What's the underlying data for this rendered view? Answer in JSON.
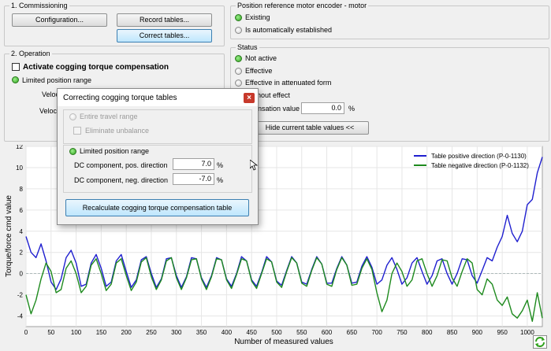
{
  "commissioning": {
    "title": "1. Commissioning",
    "configuration_btn": "Configuration...",
    "record_tables_btn": "Record tables...",
    "correct_tables_btn": "Correct tables..."
  },
  "position_reference": {
    "title": "Position reference motor encoder - motor",
    "existing": "Existing",
    "auto": "Is automatically established"
  },
  "operation": {
    "title": "2. Operation",
    "activate_label": "Activate cogging torque compensation",
    "limited_range": "Limited position range",
    "velo1": "Veloc",
    "velo2": "Veloc"
  },
  "status": {
    "title": "Status",
    "not_active": "Not active",
    "effective": "Effective",
    "attenuated": "Effective in attenuated form",
    "without_effect": "hout effect",
    "compensation_label": "nsation value",
    "compensation_value": "0.0",
    "compensation_unit": "%",
    "hide_btn": "Hide current table values <<"
  },
  "dialog": {
    "title": "Correcting cogging torque tables",
    "close": "×",
    "entire_travel": "Entire travel range",
    "eliminate_unbalance": "Eliminate unbalance",
    "limited_range": "Limited position range",
    "dc_pos_label": "DC component, pos. direction",
    "dc_pos_value": "7.0",
    "dc_pos_unit": "%",
    "dc_neg_label": "DC component, neg. direction",
    "dc_neg_value": "-7.0",
    "dc_neg_unit": "%",
    "recalc_btn": "Recalculate cogging torque compensation table"
  },
  "colors": {
    "positive": "#1f1fcf",
    "negative": "#1e8a1e",
    "accent": "#3c7fb1"
  },
  "chart_data": {
    "type": "line",
    "xlabel": "Number of measured values",
    "ylabel": "Torque/force cmd value",
    "xlim": [
      0,
      1030
    ],
    "ylim": [
      -5,
      12
    ],
    "xticks": [
      0,
      50,
      100,
      150,
      200,
      250,
      300,
      350,
      400,
      450,
      500,
      550,
      600,
      650,
      700,
      750,
      800,
      850,
      900,
      950,
      1000
    ],
    "yticks": [
      -4,
      -2,
      0,
      2,
      4,
      6,
      8,
      10,
      12
    ],
    "grid": true,
    "legend_position": "top-right",
    "series": [
      {
        "name": "Table positive direction (P-0-1130)",
        "color": "#1f1fcf",
        "x": [
          0,
          10,
          20,
          30,
          40,
          50,
          60,
          70,
          80,
          90,
          100,
          110,
          120,
          130,
          140,
          150,
          160,
          170,
          180,
          190,
          200,
          210,
          220,
          230,
          240,
          250,
          260,
          270,
          280,
          290,
          300,
          310,
          320,
          330,
          340,
          350,
          360,
          370,
          380,
          390,
          400,
          410,
          420,
          430,
          440,
          450,
          460,
          470,
          480,
          490,
          500,
          510,
          520,
          530,
          540,
          550,
          560,
          570,
          580,
          590,
          600,
          610,
          620,
          630,
          640,
          650,
          660,
          670,
          680,
          690,
          700,
          710,
          720,
          730,
          740,
          750,
          760,
          770,
          780,
          790,
          800,
          810,
          820,
          830,
          840,
          850,
          860,
          870,
          880,
          890,
          900,
          910,
          920,
          930,
          940,
          950,
          960,
          970,
          980,
          990,
          1000,
          1010,
          1020,
          1030
        ],
        "y": [
          3.5,
          2.0,
          1.5,
          2.8,
          1.2,
          -0.8,
          -1.5,
          -0.5,
          1.5,
          2.2,
          1.0,
          -1.2,
          -1.0,
          1.0,
          1.8,
          0.5,
          -1.2,
          -0.8,
          1.2,
          1.8,
          0.2,
          -1.3,
          -0.6,
          1.3,
          1.6,
          0.0,
          -1.3,
          -0.5,
          1.4,
          1.5,
          -0.2,
          -1.3,
          -0.3,
          1.5,
          1.4,
          -0.4,
          -1.3,
          -0.2,
          1.5,
          1.3,
          -0.5,
          -1.2,
          0.0,
          1.6,
          1.2,
          -0.6,
          -1.2,
          0.1,
          1.6,
          1.1,
          -0.7,
          -1.1,
          0.3,
          1.6,
          1.0,
          -0.8,
          -1.0,
          0.4,
          1.6,
          0.9,
          -0.9,
          -0.9,
          0.5,
          1.6,
          0.8,
          -0.9,
          -0.8,
          0.7,
          1.6,
          0.6,
          -1.0,
          -0.6,
          0.8,
          1.5,
          0.4,
          -1.0,
          -0.4,
          1.0,
          1.5,
          0.2,
          -1.0,
          -0.2,
          1.2,
          1.4,
          0.0,
          -1.0,
          0.0,
          1.4,
          1.3,
          -0.2,
          -0.9,
          0.3,
          1.5,
          1.2,
          2.5,
          3.5,
          5.5,
          3.8,
          3.0,
          4.0,
          6.5,
          7.0,
          9.5,
          11.0
        ]
      },
      {
        "name": "Table negative direction (P-0-1132)",
        "color": "#1e8a1e",
        "x": [
          0,
          10,
          20,
          30,
          40,
          50,
          60,
          70,
          80,
          90,
          100,
          110,
          120,
          130,
          140,
          150,
          160,
          170,
          180,
          190,
          200,
          210,
          220,
          230,
          240,
          250,
          260,
          270,
          280,
          290,
          300,
          310,
          320,
          330,
          340,
          350,
          360,
          370,
          380,
          390,
          400,
          410,
          420,
          430,
          440,
          450,
          460,
          470,
          480,
          490,
          500,
          510,
          520,
          530,
          540,
          550,
          560,
          570,
          580,
          590,
          600,
          610,
          620,
          630,
          640,
          650,
          660,
          670,
          680,
          690,
          700,
          710,
          720,
          730,
          740,
          750,
          760,
          770,
          780,
          790,
          800,
          810,
          820,
          830,
          840,
          850,
          860,
          870,
          880,
          890,
          900,
          910,
          920,
          930,
          940,
          950,
          960,
          970,
          980,
          990,
          1000,
          1010,
          1020,
          1030
        ],
        "y": [
          -2.0,
          -3.8,
          -2.5,
          -0.5,
          1.0,
          0.2,
          -1.8,
          -1.5,
          0.5,
          1.2,
          0.0,
          -1.8,
          -1.2,
          0.8,
          1.4,
          0.0,
          -1.6,
          -1.0,
          1.0,
          1.4,
          -0.2,
          -1.6,
          -0.8,
          1.1,
          1.5,
          -0.3,
          -1.5,
          -0.6,
          1.2,
          1.5,
          -0.4,
          -1.5,
          -0.4,
          1.3,
          1.4,
          -0.5,
          -1.5,
          -0.3,
          1.4,
          1.3,
          -0.6,
          -1.4,
          -0.1,
          1.4,
          1.2,
          -0.7,
          -1.4,
          0.0,
          1.4,
          1.1,
          -0.8,
          -1.3,
          0.2,
          1.5,
          1.0,
          -0.9,
          -1.2,
          0.3,
          1.5,
          0.9,
          -1.0,
          -1.2,
          0.4,
          1.5,
          0.8,
          -1.1,
          -1.0,
          0.5,
          1.4,
          0.4,
          -1.8,
          -3.6,
          -2.5,
          0.0,
          1.0,
          0.2,
          -1.2,
          -0.6,
          1.2,
          1.4,
          0.0,
          -1.2,
          -0.2,
          1.3,
          1.2,
          -0.4,
          -1.2,
          0.2,
          1.4,
          1.0,
          -1.5,
          -2.0,
          -0.5,
          -1.0,
          -2.5,
          -3.0,
          -2.2,
          -3.8,
          -4.2,
          -3.5,
          -2.5,
          -4.5,
          -1.8,
          -4.2
        ]
      }
    ]
  }
}
